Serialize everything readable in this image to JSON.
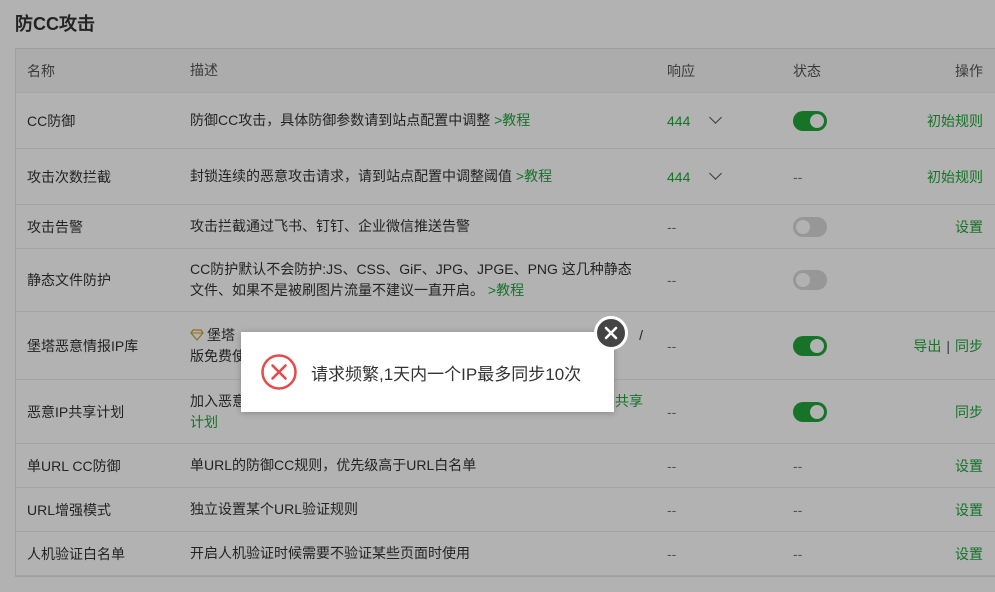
{
  "page": {
    "title": "防CC攻击"
  },
  "table": {
    "headers": {
      "name": "名称",
      "desc": "描述",
      "response": "响应",
      "status": "状态",
      "op": "操作"
    },
    "rows": [
      {
        "name": "CC防御",
        "desc": "防御CC攻击，具体防御参数请到站点配置中调整",
        "desc_link": ">教程",
        "response": "444",
        "status": true,
        "op1": "初始规则"
      },
      {
        "name": "攻击次数拦截",
        "desc": "封锁连续的恶意攻击请求，请到站点配置中调整阈值",
        "desc_link": ">教程",
        "response": "444",
        "status_text": "--",
        "op1": "初始规则"
      },
      {
        "name": "攻击告警",
        "desc": "攻击拦截通过飞书、钉钉、企业微信推送告警",
        "response": "--",
        "status": false,
        "op1": "设置"
      },
      {
        "name": "静态文件防护",
        "desc_line1": "CC防护默认不会防护:JS、CSS、GiF、JPG、JPGE、PNG 这几种静态",
        "desc_line2": "文件、如果不是被刷图片流量不建议一直开启。",
        "desc_link": ">教程",
        "response": "--",
        "status": false
      },
      {
        "name": "堡塔恶意情报IP库",
        "desc_line1": "堡塔",
        "desc_tail1": "/",
        "desc_line2": "版免费使",
        "response": "--",
        "status": true,
        "op1": "导出",
        "op_sep": "|",
        "op2": "同步"
      },
      {
        "name": "恶意IP共享计划",
        "desc_line1": "加入恶意",
        "desc_tail1": "共享",
        "desc_line2": "计划",
        "response": "--",
        "status": true,
        "op1": "同步"
      },
      {
        "name": "单URL CC防御",
        "desc": "单URL的防御CC规则，优先级高于URL白名单",
        "response": "--",
        "status_text": "--",
        "op1": "设置"
      },
      {
        "name": "URL增强模式",
        "desc": "独立设置某个URL验证规则",
        "response": "--",
        "status_text": "--",
        "op1": "设置"
      },
      {
        "name": "人机验证白名单",
        "desc": "开启人机验证时候需要不验证某些页面时使用",
        "response": "--",
        "status_text": "--",
        "op1": "设置"
      }
    ]
  },
  "dialog": {
    "message": "请求频繁,1天内一个IP最多同步10次",
    "icon": "error-circle-icon",
    "close_icon": "close-icon"
  },
  "colors": {
    "accent": "#20a53a",
    "error": "#e64a4a",
    "overlay": "rgba(0,0,0,0.3)"
  }
}
